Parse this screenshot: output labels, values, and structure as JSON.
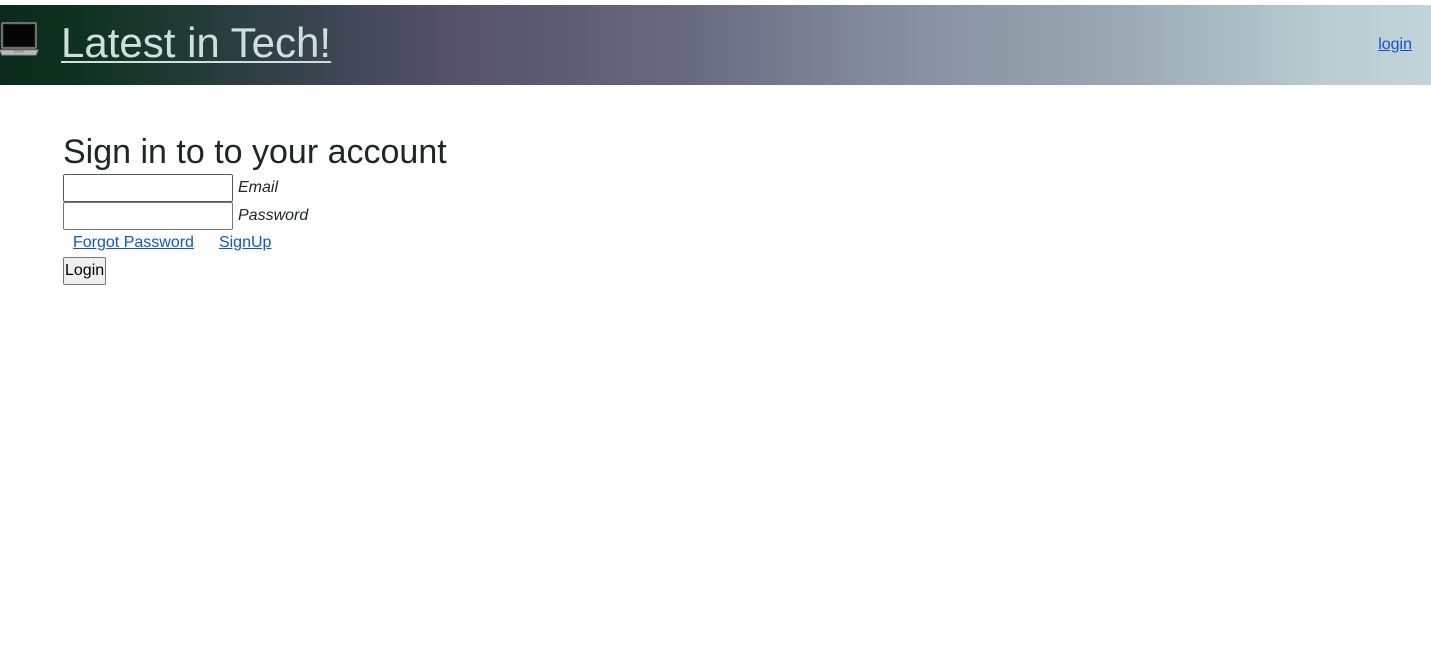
{
  "header": {
    "logo_icon": "laptop-icon",
    "title": "Latest in Tech!",
    "login_link": "login"
  },
  "form": {
    "heading": "Sign in to to your account",
    "email": {
      "label": "Email",
      "value": "",
      "placeholder": ""
    },
    "password": {
      "label": "Password",
      "value": "",
      "placeholder": ""
    },
    "links": {
      "forgot": "Forgot Password",
      "signup": "SignUp"
    },
    "submit_label": "Login"
  },
  "colors": {
    "link": "#0d53d4",
    "title": "#cfe0dc",
    "text": "#212529"
  }
}
